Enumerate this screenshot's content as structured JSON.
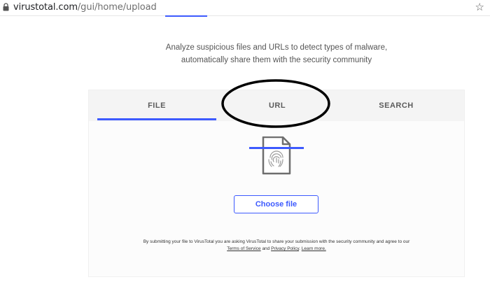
{
  "browser": {
    "url_host": "virustotal.com",
    "url_path": "/gui/home/upload",
    "star_icon": "star-outline-icon",
    "lock_icon": "lock-icon"
  },
  "hero": {
    "tagline_line1": "Analyze suspicious files and URLs to detect types of malware,",
    "tagline_line2": "automatically share them with the security community"
  },
  "tabs": [
    {
      "label": "FILE",
      "active": true
    },
    {
      "label": "URL",
      "active": false
    },
    {
      "label": "SEARCH",
      "active": false
    }
  ],
  "upload": {
    "icon": "fingerprint-file-icon",
    "choose_label": "Choose file"
  },
  "disclaimer": {
    "text": "By submitting your file to VirusTotal you are asking VirusTotal to share your submission with the security community and agree to our",
    "terms_link": "Terms of Service",
    "and_text": "and",
    "privacy_link": "Privacy Policy",
    "learn_more_link": "Learn more."
  },
  "colors": {
    "accent": "#3d5afe",
    "annotation": "#000000"
  }
}
